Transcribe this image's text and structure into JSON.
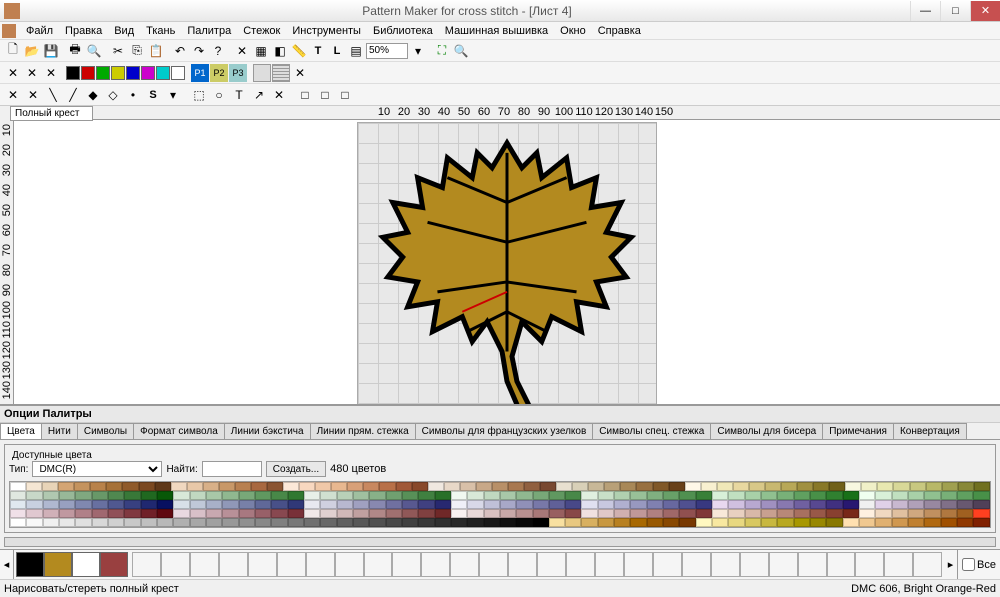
{
  "title": "Pattern Maker for cross stitch - [Лист 4]",
  "menu": [
    "Файл",
    "Правка",
    "Вид",
    "Ткань",
    "Палитра",
    "Стежок",
    "Инструменты",
    "Библиотека",
    "Машинная вышивка",
    "Окно",
    "Справка"
  ],
  "zoom": "50%",
  "stitch_type": "Полный крест",
  "ruler_h": [
    "10",
    "20",
    "30",
    "40",
    "50",
    "60",
    "70",
    "80",
    "90",
    "100",
    "110",
    "120",
    "130",
    "140",
    "150"
  ],
  "ruler_v": [
    "10",
    "20",
    "30",
    "40",
    "50",
    "60",
    "70",
    "80",
    "90",
    "100",
    "110",
    "120",
    "130",
    "140"
  ],
  "panel": {
    "title": "Опции Палитры",
    "tabs": [
      "Цвета",
      "Нити",
      "Символы",
      "Формат символа",
      "Линии бэкстича",
      "Линии прям. стежка",
      "Символы для французских узелков",
      "Символы спец. стежка",
      "Символы для бисера",
      "Примечания",
      "Конвертация"
    ],
    "fieldset": "Доступные цвета",
    "type_label": "Тип:",
    "type_value": "DMC(R)",
    "find_label": "Найти:",
    "create_label": "Создать...",
    "count": "480 цветов"
  },
  "used_colors": [
    "#000000",
    "#b38a1f",
    "#ffffff",
    "#994040"
  ],
  "all_checkbox": "Все",
  "status": {
    "left": "Нарисовать/стереть полный крест",
    "right": "DMC  606, Bright Orange-Red"
  },
  "palette_colors": [
    [
      "#fff",
      "#f5e6d3",
      "#e8d4b8",
      "#d4a574",
      "#c4935e",
      "#b8824a",
      "#a67138",
      "#8f5a2a",
      "#7a4820",
      "#5e3718",
      "#f0d8c0",
      "#e8c8a8",
      "#d8b088",
      "#c89868",
      "#b88050",
      "#a86840",
      "#8a5432",
      "#fce8d8",
      "#f8d8c0",
      "#f0c8a8",
      "#e8b890",
      "#d8a078",
      "#c88860",
      "#b87048",
      "#a05838",
      "#88482a",
      "#f0e8e0",
      "#e8d8c8",
      "#d8c0a8",
      "#c8a888",
      "#b89068",
      "#a87850",
      "#906040",
      "#784830",
      "#e8e0d0",
      "#d8d0b8",
      "#c8b898",
      "#b8a078",
      "#a88858",
      "#987040",
      "#805828",
      "#684018",
      "#fff8e8",
      "#f8f0d0",
      "#f0e8b8",
      "#e8d8a0",
      "#d8c888",
      "#c8b870",
      "#b8a858",
      "#a09040",
      "#887828",
      "#706018",
      "#f8f8e0",
      "#f0f0c8",
      "#e8e8b0",
      "#d8d898",
      "#c8c880",
      "#b8b868",
      "#a0a050",
      "#888838",
      "#707020"
    ],
    [
      "#e0e8e0",
      "#c8d8c8",
      "#b0c8b0",
      "#98b898",
      "#80a880",
      "#689868",
      "#508850",
      "#387838",
      "#206820",
      "#085808",
      "#d8e8d8",
      "#c0d8c0",
      "#a8c8a8",
      "#90b890",
      "#78a878",
      "#609860",
      "#488848",
      "#307830",
      "#e8f0e8",
      "#d0e0d0",
      "#b8d0b8",
      "#a0c0a0",
      "#88b088",
      "#70a070",
      "#589058",
      "#408040",
      "#287028",
      "#f0f8f0",
      "#d8e8d8",
      "#c0d8c0",
      "#a8c8a8",
      "#90b890",
      "#78a878",
      "#609860",
      "#488848",
      "#e0f0e0",
      "#c8e0c8",
      "#b0d0b0",
      "#98c098",
      "#80b080",
      "#68a068",
      "#509050",
      "#388038",
      "#d8f0d8",
      "#c0e0c0",
      "#a8d0a8",
      "#90c090",
      "#78b078",
      "#60a060",
      "#489048",
      "#308030",
      "#187018",
      "#f0fff0",
      "#d8f0d8",
      "#c0e0c0",
      "#a8d0a8",
      "#90c090",
      "#78b078",
      "#60a060",
      "#489048"
    ],
    [
      "#e0e8f0",
      "#c8d0e0",
      "#b0b8d0",
      "#98a0c0",
      "#8088b0",
      "#6870a0",
      "#505890",
      "#384080",
      "#202870",
      "#081060",
      "#d8e0e8",
      "#c0c8d8",
      "#a8b0c8",
      "#9098b8",
      "#7880a8",
      "#606898",
      "#485088",
      "#303878",
      "#e8e8f0",
      "#d0d0e0",
      "#b8b8d0",
      "#a0a0c0",
      "#8888b0",
      "#7070a0",
      "#585890",
      "#404080",
      "#282870",
      "#f0f0f8",
      "#d8d8e8",
      "#c0c0d8",
      "#a8a8c8",
      "#9090b8",
      "#7878a8",
      "#606098",
      "#484888",
      "#e0e0f0",
      "#c8c8e0",
      "#b0b0d0",
      "#9898c0",
      "#8080b0",
      "#6868a0",
      "#505090",
      "#383880",
      "#e8d8f0",
      "#d0c0e0",
      "#b8a8d0",
      "#a090c0",
      "#8878b0",
      "#7060a0",
      "#584890",
      "#403080",
      "#281870",
      "#f8e8fff",
      "#e0d0e8",
      "#c8b8d0",
      "#b0a0b8",
      "#9888a0",
      "#807088",
      "#685870",
      "#504058"
    ],
    [
      "#f0e0e8",
      "#e0c8d0",
      "#d0b0b8",
      "#c098a0",
      "#b08088",
      "#a06870",
      "#905058",
      "#803840",
      "#702028",
      "#600810",
      "#e8d8e0",
      "#d8c0c8",
      "#c8a8b0",
      "#b89098",
      "#a87880",
      "#986068",
      "#884850",
      "#783038",
      "#f0e8e8",
      "#e0d0d0",
      "#d0b8b8",
      "#c0a0a0",
      "#b08888",
      "#a07070",
      "#905858",
      "#804040",
      "#702828",
      "#f8f0f0",
      "#e8d8d8",
      "#d8c0c0",
      "#c8a8a8",
      "#b89090",
      "#a87878",
      "#986060",
      "#884848",
      "#f0e0e0",
      "#e0c8c8",
      "#d0b0b0",
      "#c09898",
      "#b08080",
      "#a06868",
      "#905050",
      "#803838",
      "#f8e8d8",
      "#e8d0c0",
      "#d8b8a8",
      "#c8a090",
      "#b88878",
      "#a87060",
      "#985848",
      "#884030",
      "#782818",
      "#fff0e0",
      "#f0d8c0",
      "#e0c0a0",
      "#d0a880",
      "#c09060",
      "#b07840",
      "#a06020",
      "#ff4020"
    ],
    [
      "#fff",
      "#f8f8f8",
      "#f0f0f0",
      "#e8e8e8",
      "#e0e0e0",
      "#d8d8d8",
      "#d0d0d0",
      "#c8c8c8",
      "#c0c0c0",
      "#b8b8b8",
      "#b0b0b0",
      "#a8a8a8",
      "#a0a0a0",
      "#989898",
      "#909090",
      "#888888",
      "#808080",
      "#787878",
      "#707070",
      "#686868",
      "#606060",
      "#585858",
      "#505050",
      "#484848",
      "#404040",
      "#383838",
      "#303030",
      "#282828",
      "#202020",
      "#181818",
      "#101010",
      "#080808",
      "#000",
      "#f8e0a0",
      "#e8c880",
      "#d8b060",
      "#c89840",
      "#b88020",
      "#a86800",
      "#985800",
      "#884800",
      "#783800",
      "#fff8c0",
      "#f8e8a0",
      "#e8d880",
      "#d8c860",
      "#c8b840",
      "#b8a820",
      "#a89800",
      "#988800",
      "#887800",
      "#ffe0b0",
      "#f0c890",
      "#e0b070",
      "#d09850",
      "#c08030",
      "#b06810",
      "#a05000",
      "#903800",
      "#802000"
    ]
  ]
}
